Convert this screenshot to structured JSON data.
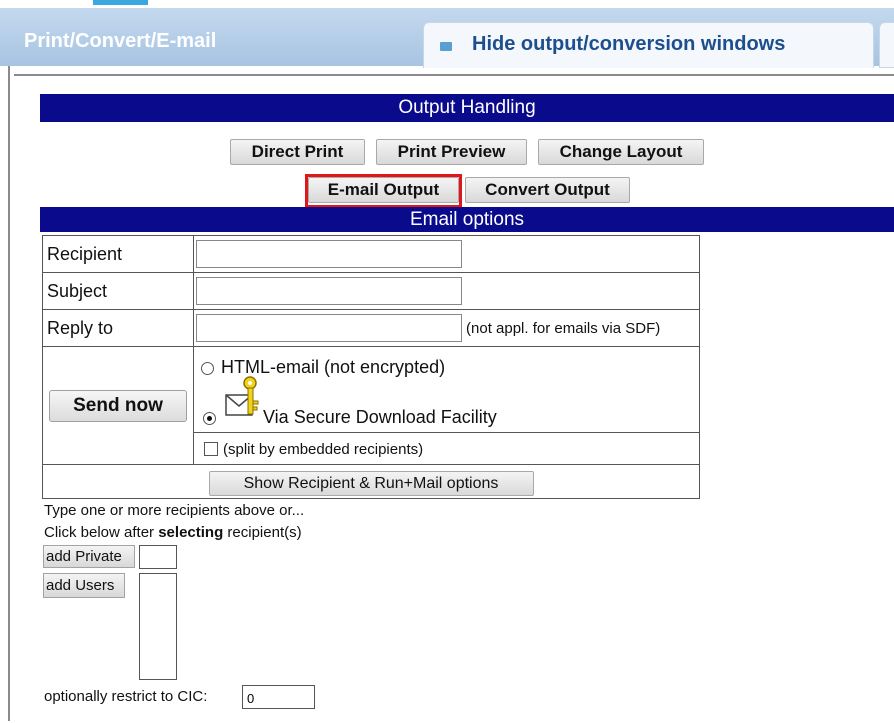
{
  "window": {
    "title": "Print/Convert/E-mail",
    "hide_tab_label": "Hide output/conversion windows"
  },
  "output_handling": {
    "header": "Output Handling",
    "buttons": {
      "direct_print": "Direct Print",
      "print_preview": "Print Preview",
      "change_layout": "Change Layout",
      "email_output": "E-mail Output",
      "convert_output": "Convert Output"
    }
  },
  "email_options": {
    "header": "Email options",
    "recipient_label": "Recipient",
    "recipient_value": "",
    "subject_label": "Subject",
    "subject_value": "",
    "reply_to_label": "Reply to",
    "reply_to_value": "",
    "reply_to_note": "(not appl. for emails via SDF)",
    "send_now": "Send now",
    "option_html": "HTML-email (not encrypted)",
    "option_sdf": "Via Secure Download Facility",
    "selected_option": "sdf",
    "split_label": "(split by embedded recipients)",
    "split_checked": false,
    "show_options_button": "Show Recipient & Run+Mail options"
  },
  "recipients_help": {
    "line1": "Type one or more recipients above or...",
    "line2_prefix": "Click below after",
    "line2_bold": "selecting",
    "line2_suffix": "recipient(s)",
    "add_private": "add Private",
    "add_users": "add Users",
    "cic_label": "optionally restrict to CIC:",
    "cic_value": "0"
  },
  "colors": {
    "navy_header": "#0a0a8c",
    "title_bar": "#b5cfe9",
    "highlight_border": "#e0161b"
  }
}
